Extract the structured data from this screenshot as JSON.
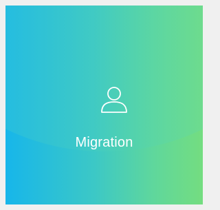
{
  "tile": {
    "label": "Migration",
    "icon": "user-icon",
    "colors": {
      "gradient_start": "#17b6ea",
      "gradient_end": "#74dd80",
      "page_background": "#f0f0f0",
      "text": "#ffffff"
    }
  }
}
